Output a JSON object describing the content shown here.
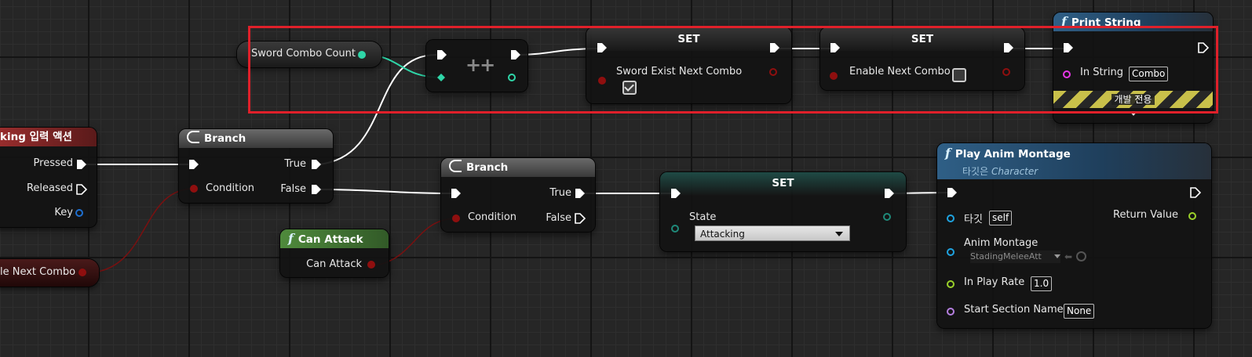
{
  "colors": {
    "exec": "#ffffff",
    "int": "#2fd6a8",
    "bool": "#8f0f0f",
    "struct": "#1e6fd0",
    "object": "#1fa3e0",
    "float": "#9bd12a",
    "string": "#e637e6",
    "name": "#b57fe0",
    "enum": "#0e6e62",
    "highlight": "#e0202a"
  },
  "input_action": {
    "title": "king 입력 액션",
    "pins": [
      "Pressed",
      "Released",
      "Key"
    ]
  },
  "enable_next_combo_var": {
    "label": "le Next Combo"
  },
  "branch1": {
    "title": "Branch",
    "condition": "Condition",
    "true": "True",
    "false": "False"
  },
  "branch2": {
    "title": "Branch",
    "condition": "Condition",
    "true": "True",
    "false": "False"
  },
  "can_attack": {
    "title": "Can Attack",
    "pin": "Can Attack"
  },
  "sword_combo_var": {
    "label": "Sword Combo Count"
  },
  "increment": {
    "symbol": "++"
  },
  "set1": {
    "title": "SET",
    "pin": "Sword Exist Next Combo",
    "checked": true
  },
  "set2": {
    "title": "SET",
    "pin": "Enable Next Combo",
    "checked": false
  },
  "print_string": {
    "title": "Print String",
    "pin": "In String",
    "value": "Combo",
    "dev_only": "개발 전용"
  },
  "set_state": {
    "title": "SET",
    "pin": "State",
    "value": "Attacking"
  },
  "play_anim": {
    "title": "Play Anim Montage",
    "subtitle_prefix": "타깃은 ",
    "subtitle_class": "Character",
    "target": "타깃",
    "target_value": "self",
    "montage": "Anim Montage",
    "montage_value": "StadingMeleeAtt",
    "rate": "In Play Rate",
    "rate_value": "1.0",
    "section": "Start Section Name",
    "section_value": "None",
    "return": "Return Value"
  }
}
